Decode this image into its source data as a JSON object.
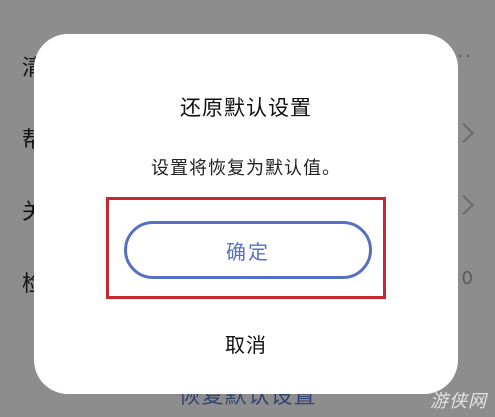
{
  "background": {
    "rows": [
      {
        "label": "清",
        "trailing": "···"
      },
      {
        "label": "帮",
        "trailing": ""
      },
      {
        "label": "关",
        "trailing": ""
      },
      {
        "label": "检",
        "trailing": "0"
      }
    ],
    "restore_link": "恢复默认设置"
  },
  "dialog": {
    "title": "还原默认设置",
    "message": "设置将恢复为默认值。",
    "confirm_label": "确定",
    "cancel_label": "取消"
  },
  "watermark": "游侠网",
  "colors": {
    "accent": "#5671c4",
    "highlight": "#c8282f"
  }
}
